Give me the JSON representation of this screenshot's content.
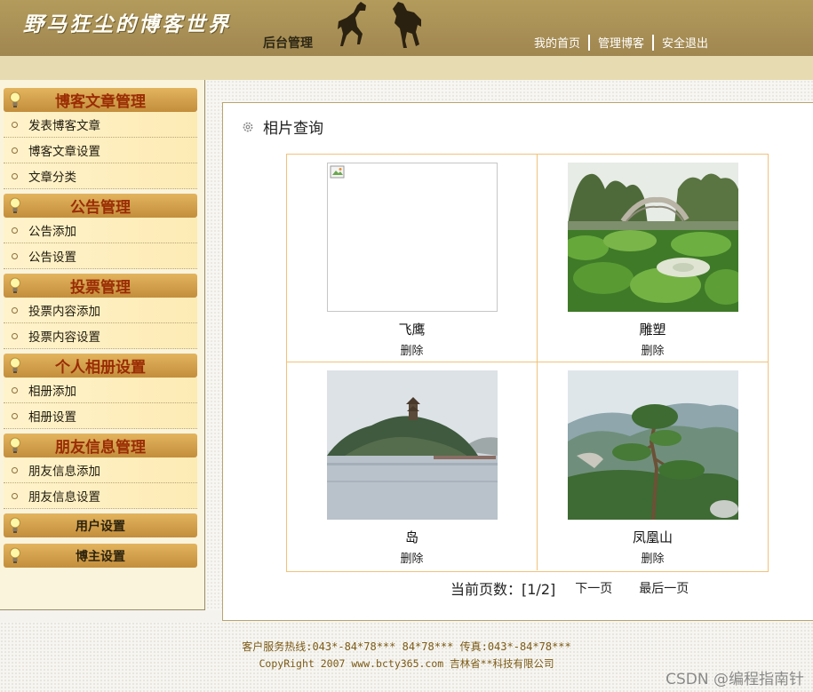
{
  "header": {
    "logo_text": "野马狂尘的博客世界",
    "subtitle": "后台管理",
    "nav": [
      "我的首页",
      "管理博客",
      "安全退出"
    ]
  },
  "sidebar": {
    "sections": [
      {
        "title": "博客文章管理",
        "items": [
          "发表博客文章",
          "博客文章设置",
          "文章分类"
        ]
      },
      {
        "title": "公告管理",
        "items": [
          "公告添加",
          "公告设置"
        ]
      },
      {
        "title": "投票管理",
        "items": [
          "投票内容添加",
          "投票内容设置"
        ]
      },
      {
        "title": "个人相册设置",
        "items": [
          "相册添加",
          "相册设置"
        ]
      },
      {
        "title": "朋友信息管理",
        "items": [
          "朋友信息添加",
          "朋友信息设置"
        ]
      },
      {
        "title": "用户设置",
        "items": []
      },
      {
        "title": "博主设置",
        "items": []
      }
    ]
  },
  "main": {
    "title": "相片查询",
    "photos": [
      {
        "caption": "飞鹰",
        "delete_label": "删除",
        "image": "broken"
      },
      {
        "caption": "雕塑",
        "delete_label": "删除",
        "image": "lotus-pond-bridge"
      },
      {
        "caption": "岛",
        "delete_label": "删除",
        "image": "island-pagoda"
      },
      {
        "caption": "凤凰山",
        "delete_label": "删除",
        "image": "mountain-pine"
      }
    ],
    "pager": {
      "label": "当前页数：[1/2]",
      "next": "下一页",
      "last": "最后一页"
    }
  },
  "footer": {
    "line1": "客户服务热线:043*-84*78*** 84*78*** 传真:043*-84*78***",
    "line2": "CopyRight 2007 www.bcty365.com 吉林省**科技有限公司"
  },
  "watermark": "CSDN @编程指南针",
  "colors": {
    "header": "#a8905a",
    "band": "#e6dbb1",
    "section_header": "#d19f4a",
    "section_text": "#9a2c04",
    "grid_border": "#f2c27a",
    "footer_text": "#7c5a16"
  }
}
